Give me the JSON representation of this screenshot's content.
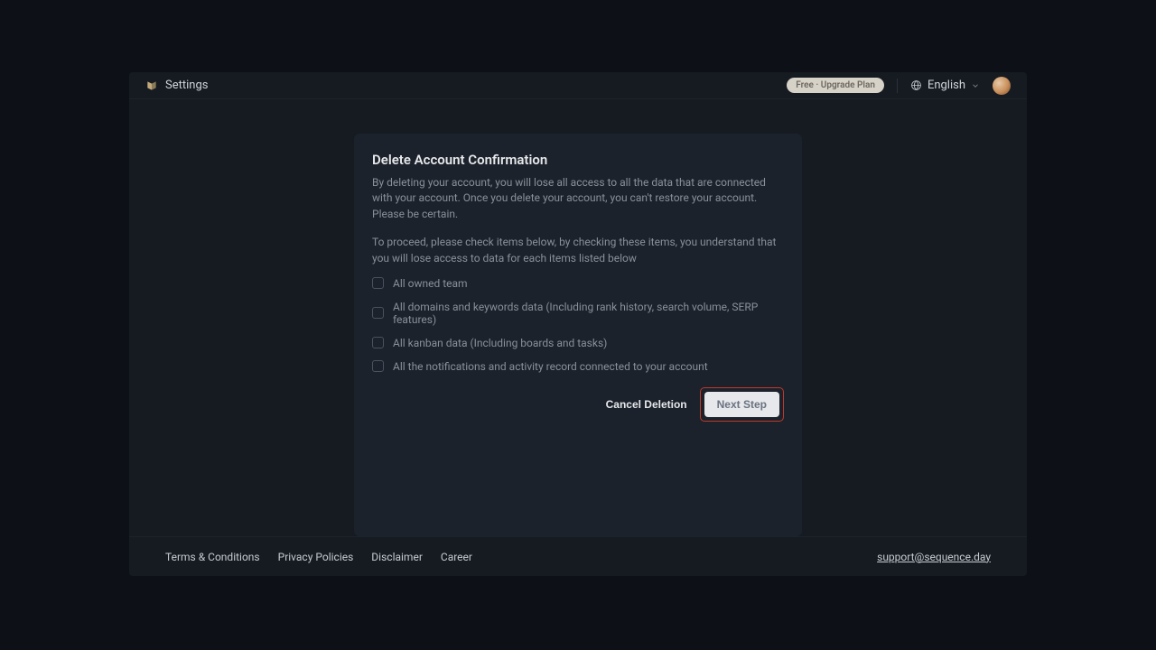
{
  "header": {
    "title": "Settings",
    "upgrade_label": "Free · Upgrade Plan",
    "language": "English"
  },
  "card": {
    "title": "Delete Account Confirmation",
    "description1": "By deleting your account, you will lose all access to all the data that are connected with your account. Once you delete your account, you can't restore your account. Please be certain.",
    "description2": "To proceed, please check items below, by checking these items, you understand that you will lose access to data for each items listed below",
    "checks": [
      "All owned team",
      "All domains and keywords data (Including rank history, search volume, SERP features)",
      "All kanban data (Including boards and tasks)",
      "All the notifications and activity record connected to your account"
    ],
    "cancel_label": "Cancel Deletion",
    "next_label": "Next Step"
  },
  "footer": {
    "links": [
      "Terms & Conditions",
      "Privacy Policies",
      "Disclaimer",
      "Career"
    ],
    "support": "support@sequence.day"
  }
}
